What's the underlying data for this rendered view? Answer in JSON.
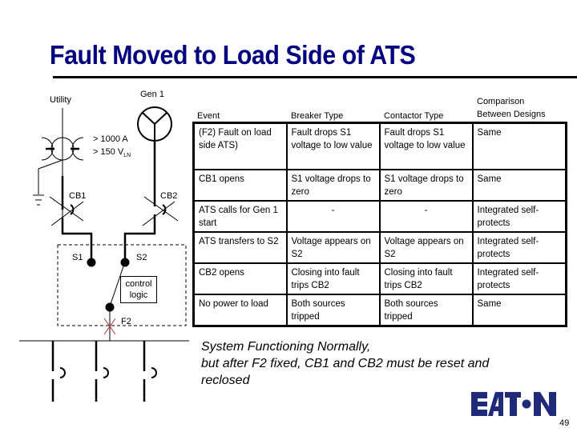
{
  "slide": {
    "title": "Fault Moved to Load Side of ATS",
    "page_number": "49",
    "brand_color": "#000080",
    "logo_text": "EATON"
  },
  "diagram": {
    "utility_label": "Utility",
    "gen_label": "Gen 1",
    "ct_rating_current": "> 1000 A",
    "ct_rating_voltage": "> 150 V",
    "ct_rating_voltage_sub": "LN",
    "cb1_label": "CB1",
    "cb2_label": "CB2",
    "s1_label": "S1",
    "s2_label": "S2",
    "control_logic_line1": "control",
    "control_logic_line2": "logic",
    "fault_label": "F2",
    "fault_color": "#c0282d"
  },
  "table": {
    "headers": [
      "Event",
      "Breaker Type",
      "Contactor Type",
      "Comparison Between Designs"
    ],
    "rows": [
      [
        "(F2) Fault  on load side ATS)",
        "Fault drops S1 voltage to low value",
        "Fault drops S1 voltage to low value",
        "Same"
      ],
      [
        "CB1 opens",
        "S1 voltage drops to zero",
        "S1 voltage drops to zero",
        "Same"
      ],
      [
        "ATS calls for Gen 1 start",
        "-",
        "-",
        "Integrated self-protects"
      ],
      [
        "ATS transfers to S2",
        "Voltage appears on S2",
        "Voltage appears on S2",
        "Integrated self-protects"
      ],
      [
        "CB2 opens",
        "Closing into fault trips CB2",
        "Closing into fault trips CB2",
        "Integrated self-protects"
      ],
      [
        "No power to load",
        "Both sources tripped",
        "Both sources tripped",
        "Same"
      ]
    ]
  },
  "note": {
    "line1": "System Functioning Normally,",
    "line2": "but after F2 fixed, CB1 and CB2 must be reset and",
    "line3": "reclosed"
  }
}
